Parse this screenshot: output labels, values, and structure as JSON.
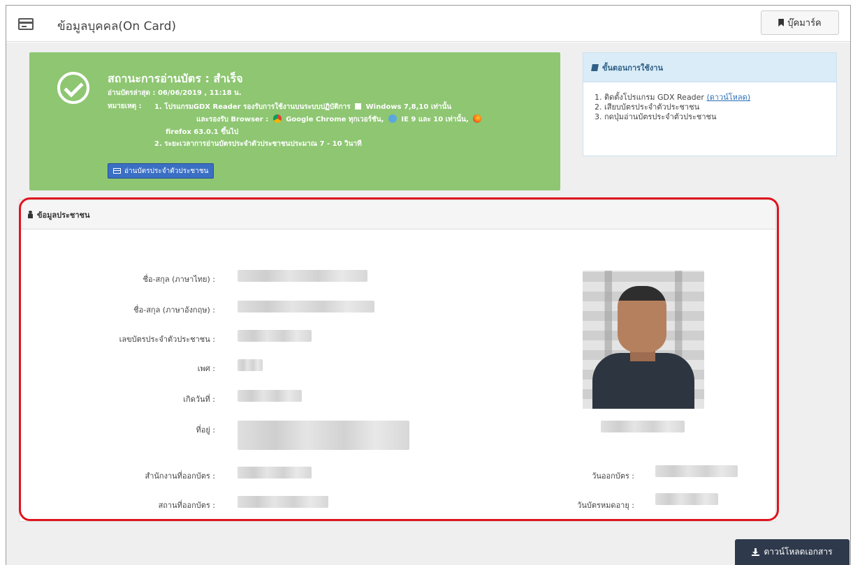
{
  "header": {
    "title": "ข้อมูลบุคคล(On Card)",
    "bookmark_label": "บุ๊คมาร์ค"
  },
  "status": {
    "title": "สถานะการอ่านบัตร : สำเร็จ",
    "last_read": "อ่านบัตรล่าสุด : 06/06/2019 , 11:18 น.",
    "note_label": "หมายเหตุ :",
    "note1_a": "1. โปรแกรมGDX Reader รองรับการใช้งานบนระบบปฏิบัติการ",
    "note1_b": "Windows 7,8,10 เท่านั้น",
    "note1_c": "และรองรับ Browser :",
    "note1_d": "Google Chrome ทุกเวอร์ชัน,",
    "note1_e": "IE 9 และ 10 เท่านั้น,",
    "note1_f": "firefox 63.0.1 ขึ้นไป",
    "note2": "2. ระยะเวลาการอ่านบัตรประจำตัวประชาชนประมาณ 7 - 10 วินาที",
    "read_button": "อ่านบัตรประจำตัวประชาชน"
  },
  "steps": {
    "title": "ขั้นตอนการใช้งาน",
    "item1": "1. ติดตั้งโปรแกรม GDX Reader",
    "item1_link": "(ดาวน์โหลด)",
    "item2": "2. เสียบบัตรประจำตัวประชาชน",
    "item3": "3. กดปุ่มอ่านบัตรประจำตัวประชาชน"
  },
  "info": {
    "title": "ข้อมูลประชาชน",
    "labels": {
      "name_th": "ชื่อ-สกุล (ภาษาไทย) :",
      "name_en": "ชื่อ-สกุล (ภาษาอังกฤษ) :",
      "id_number": "เลขบัตรประจำตัวประชาชน :",
      "gender": "เพศ :",
      "birth_date": "เกิดวันที่ :",
      "address": "ที่อยู่ :",
      "issuing_office": "สำนักงานที่ออกบัตร :",
      "issuing_place": "สถานที่ออกบัตร :",
      "issue_date": "วันออกบัตร :",
      "expiry_date": "วันบัตรหมดอายุ :"
    }
  },
  "footer": {
    "download_label": "ดาวน์โหลดเอกสาร"
  },
  "colors": {
    "status_bg": "#8ec672",
    "button_blue": "#3a6fc4",
    "steps_header_bg": "#d9ecf7",
    "highlight_red": "#e0141e",
    "download_btn_bg": "#2e3a4c"
  }
}
